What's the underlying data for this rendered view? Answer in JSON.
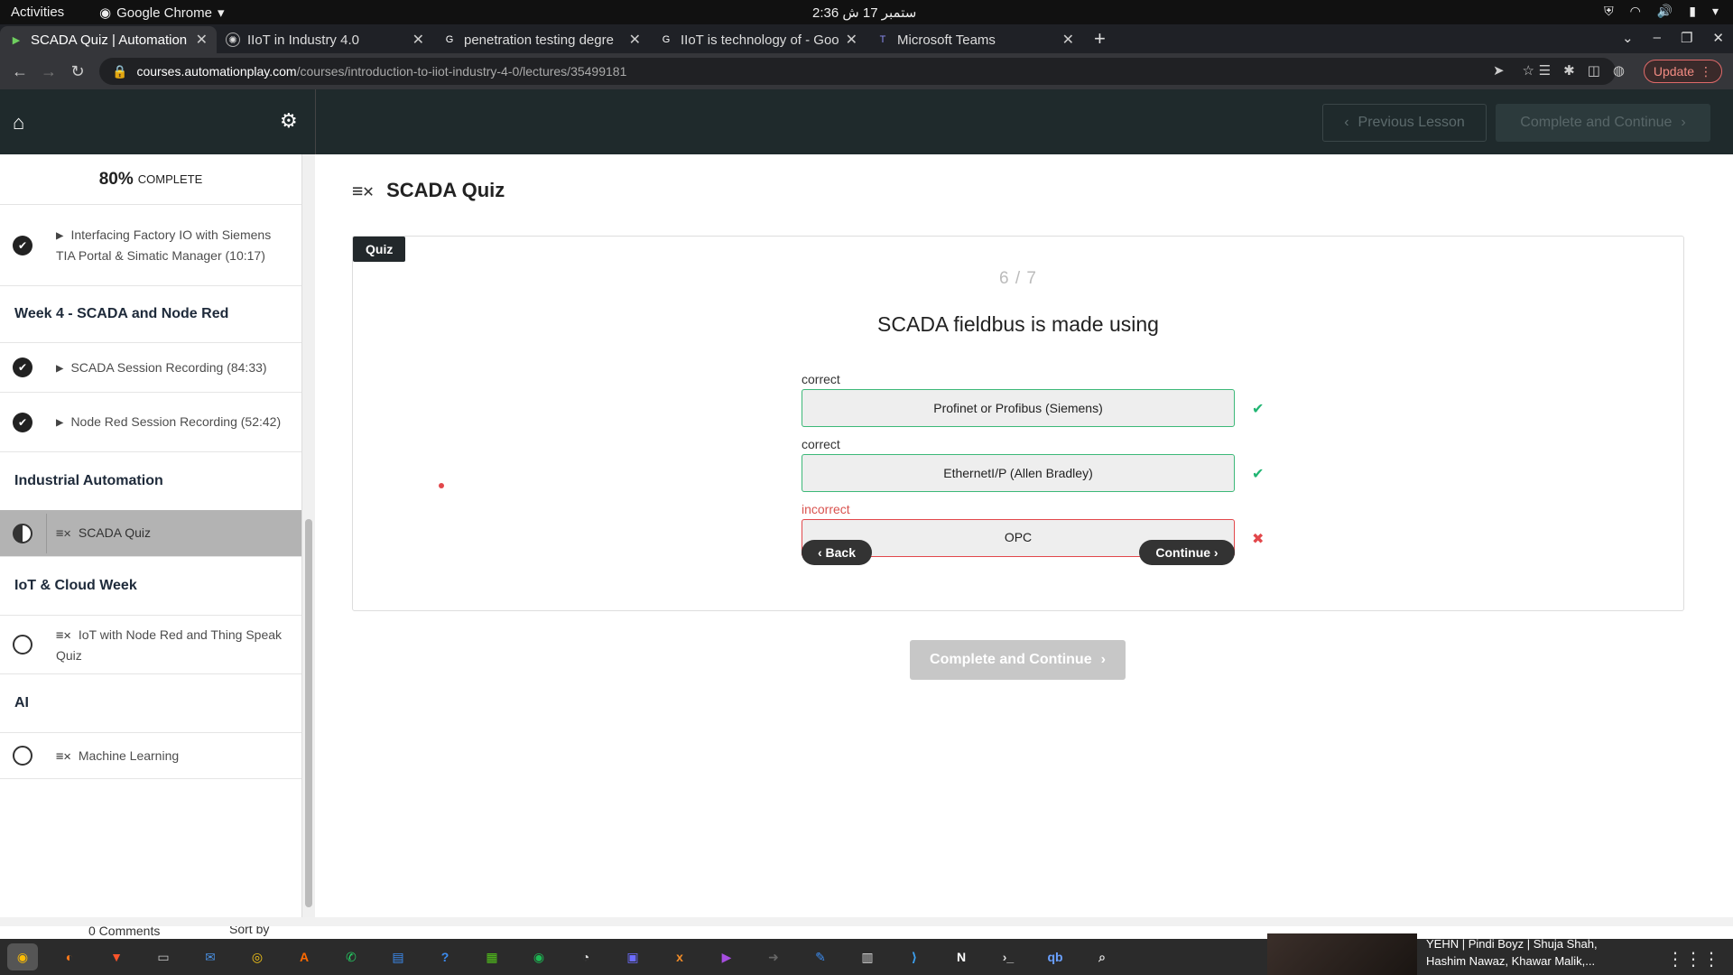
{
  "os": {
    "activities": "Activities",
    "app_name": "Google Chrome",
    "clock": "2:36 ستمبر 17 ش"
  },
  "tabs": [
    {
      "title": "SCADA Quiz | Automation",
      "active": true
    },
    {
      "title": "IIoT in Industry 4.0",
      "active": false
    },
    {
      "title": "penetration testing degre",
      "active": false
    },
    {
      "title": "IIoT is technology of - Goo",
      "active": false
    },
    {
      "title": "Microsoft Teams",
      "active": false
    }
  ],
  "browser": {
    "url_domain": "courses.automationplay.com",
    "url_path": "/courses/introduction-to-iiot-industry-4-0/lectures/35499181",
    "update_label": "Update"
  },
  "header": {
    "prev_lesson": "Previous Lesson",
    "complete_continue": "Complete and Continue"
  },
  "sidebar": {
    "progress_pct": "80%",
    "progress_label": "COMPLETE",
    "lesson_interfacing": "Interfacing Factory IO with Siemens TIA Portal & Simatic Manager (10:17)",
    "section_week4": "Week 4 - SCADA and Node Red",
    "lesson_scada_session": "SCADA Session Recording (84:33)",
    "lesson_nodered_session": "Node Red Session Recording (52:42)",
    "section_industrial": "Industrial Automation",
    "lesson_scada_quiz": "SCADA Quiz",
    "section_iot": "IoT & Cloud Week",
    "lesson_iot_quiz": "IoT with Node Red and Thing Speak Quiz",
    "section_ai": "AI",
    "lesson_ml": "Machine Learning"
  },
  "main": {
    "title": "SCADA Quiz",
    "quiz_tag": "Quiz",
    "question_count": "6 / 7",
    "question": "SCADA fieldbus is made using",
    "answers": [
      {
        "status": "correct",
        "text": "Profinet or Profibus (Siemens)"
      },
      {
        "status": "correct",
        "text": "EthernetI/P (Allen Bradley)"
      },
      {
        "status": "incorrect",
        "text": "OPC"
      }
    ],
    "back_label": "‹ Back",
    "continue_label": "Continue ›",
    "complete_continue": "Complete and Continue"
  },
  "comments_peek": {
    "comments": "0 Comments",
    "sort": "Sort by"
  },
  "media": {
    "track": "YEHN | Pindi Boyz | Shuja Shah, Hashim Nawaz, Khawar Malik,..."
  },
  "colors": {
    "accent_dark": "#1f2a2c",
    "correct_green": "#21b573",
    "incorrect_red": "#e2474b"
  }
}
